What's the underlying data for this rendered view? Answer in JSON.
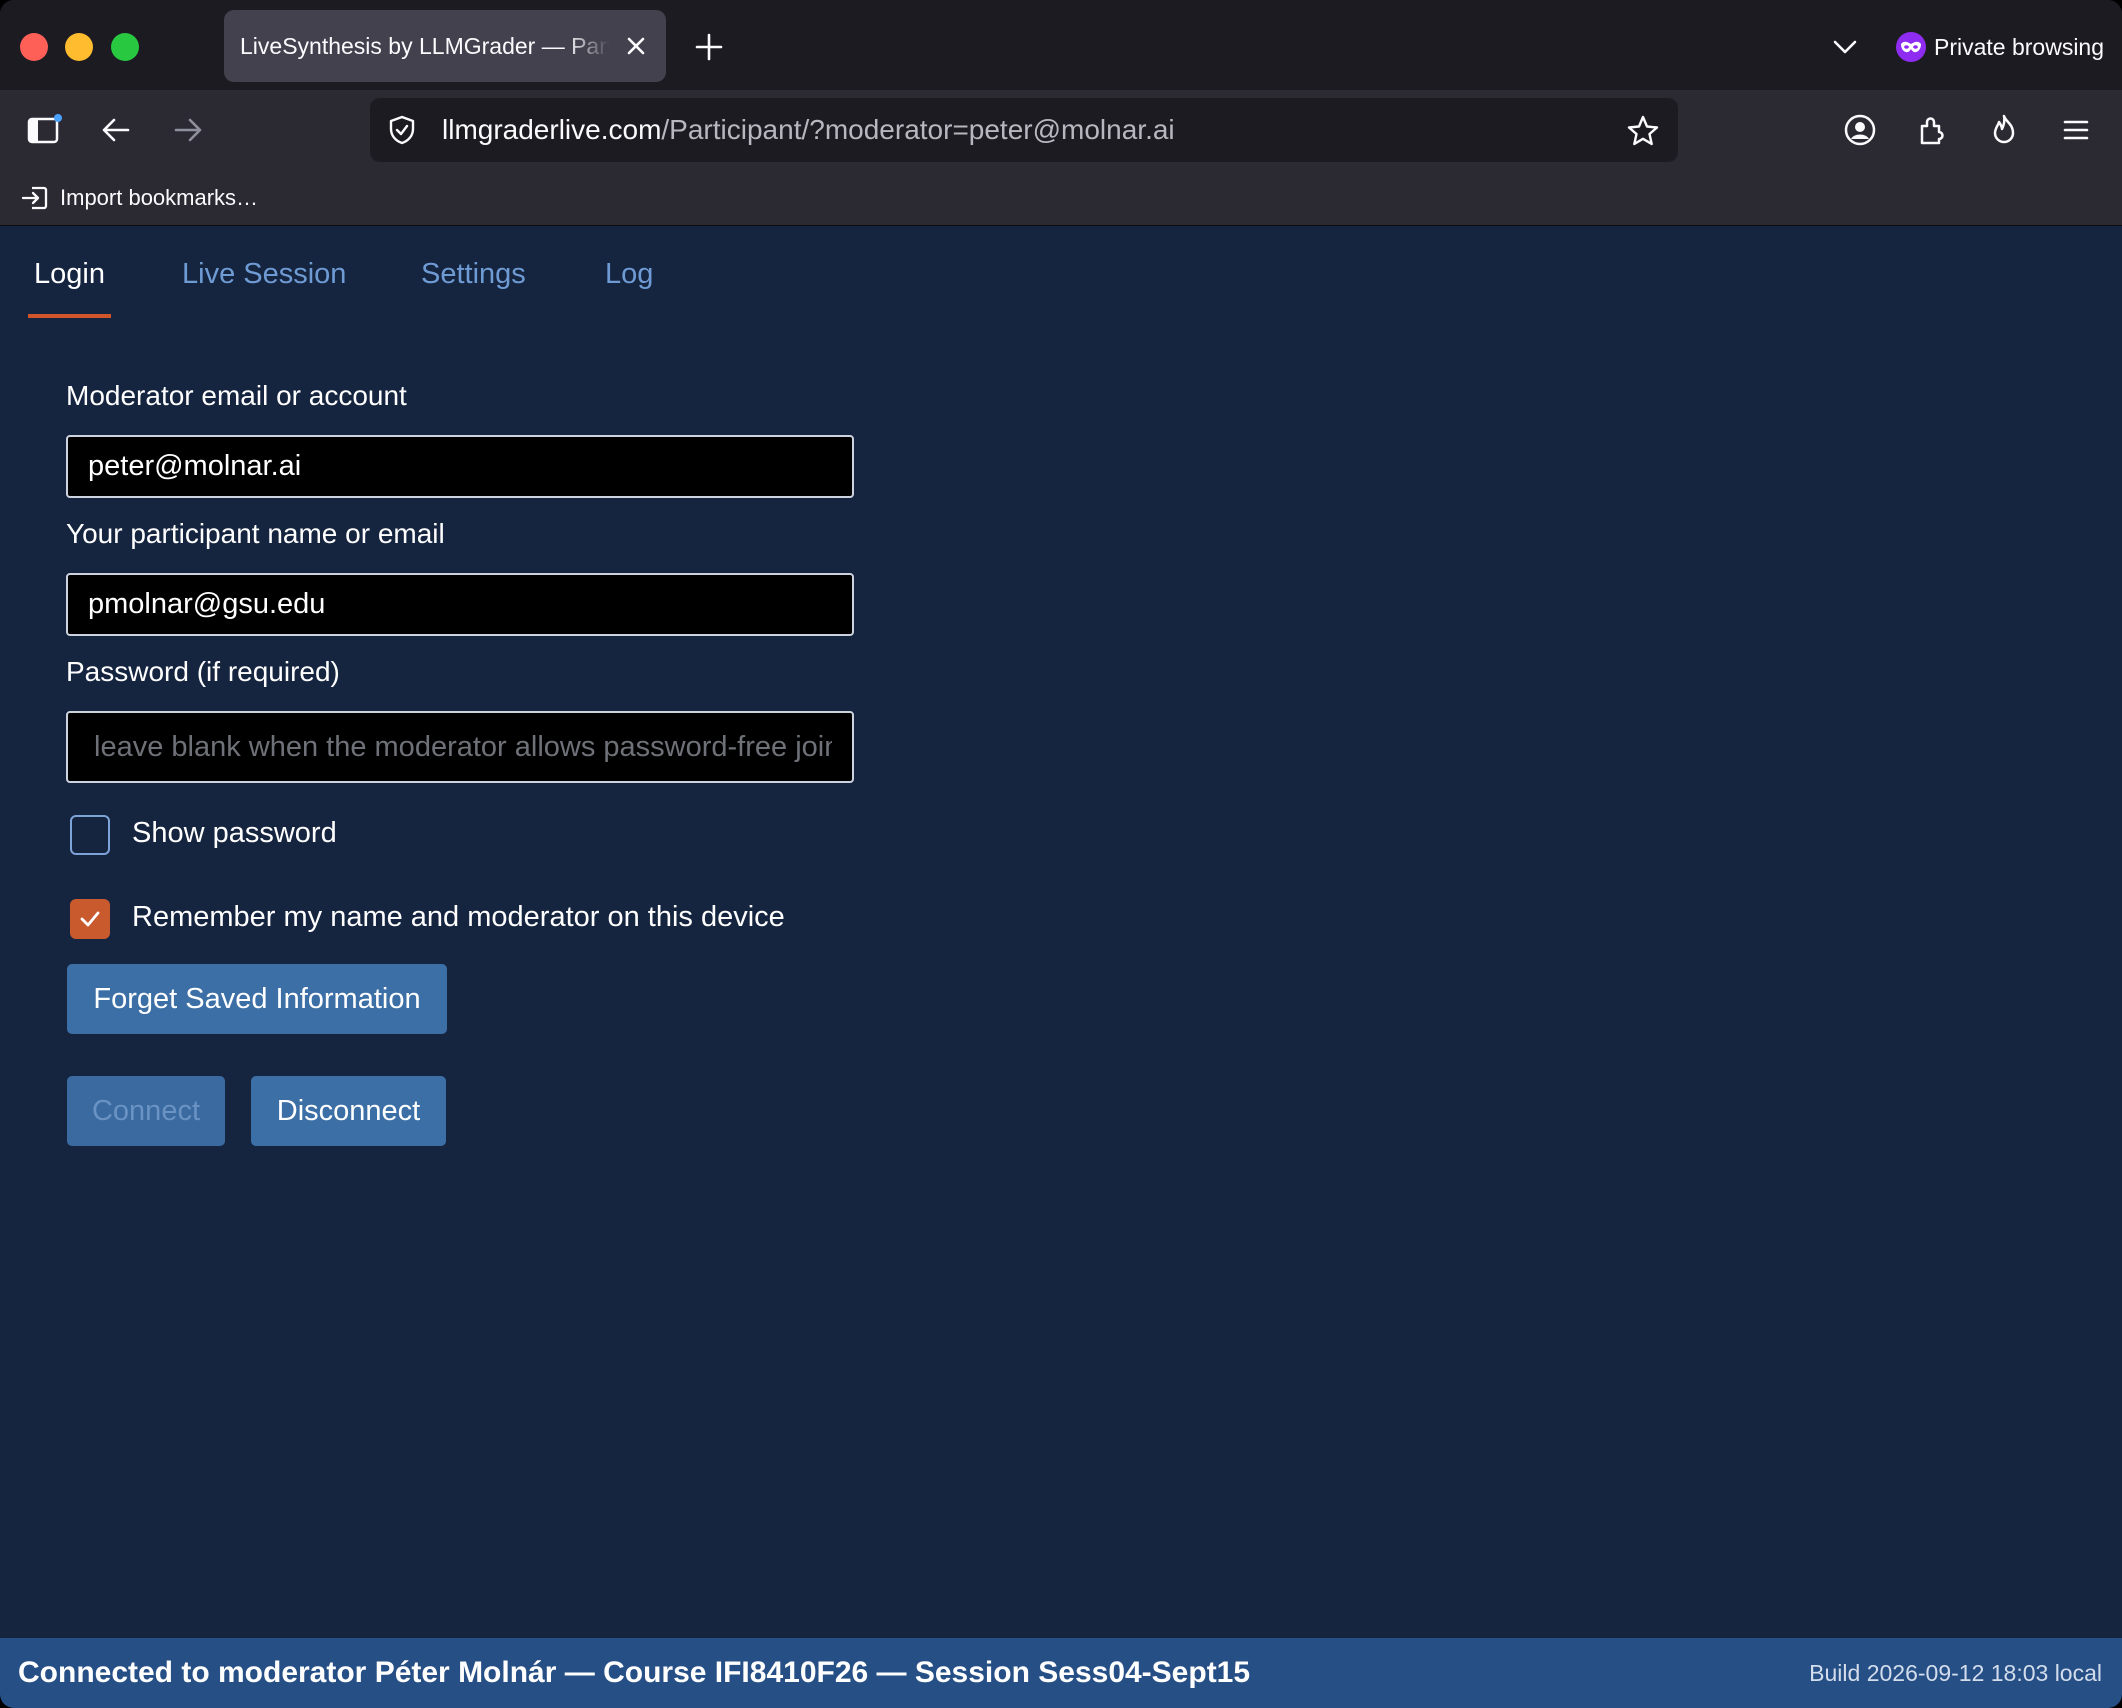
{
  "browser": {
    "tab_title": "LiveSynthesis by LLMGrader — Participant",
    "private_label": "Private browsing",
    "url_domain": "llmgraderlive.com",
    "url_path": "/Participant/?moderator=peter@molnar.ai",
    "bookmarks_import": "Import bookmarks…"
  },
  "tabs": [
    {
      "label": "Login",
      "active": true
    },
    {
      "label": "Live Session",
      "active": false
    },
    {
      "label": "Settings",
      "active": false
    },
    {
      "label": "Log",
      "active": false
    }
  ],
  "form": {
    "moderator_label": "Moderator email or account",
    "moderator_value": "peter@molnar.ai",
    "participant_label": "Your participant name or email",
    "participant_value": "pmolnar@gsu.edu",
    "password_label": "Password (if required)",
    "password_value": "",
    "password_placeholder": "leave blank when the moderator allows password-free join",
    "show_password_label": "Show password",
    "show_password_checked": false,
    "remember_label": "Remember my name and moderator on this device",
    "remember_checked": true,
    "forget_button": "Forget Saved Information",
    "connect_button": "Connect",
    "connect_disabled": true,
    "disconnect_button": "Disconnect"
  },
  "status": {
    "message": "Connected to moderator Péter Molnár — Course IFI8410F26 — Session Sess04-Sept15",
    "build": "Build 2026-09-12 18:03 local"
  },
  "colors": {
    "page_bg": "#15243f",
    "accent": "#d0552b",
    "button": "#3c6fa6",
    "status_bar": "#264f86"
  },
  "icons": [
    "close-icon",
    "plus-icon",
    "chevron-down-icon",
    "private-mask-icon",
    "sidebar-icon",
    "back-arrow-icon",
    "forward-arrow-icon",
    "shield-icon",
    "star-icon",
    "account-icon",
    "extensions-icon",
    "firefox-view-icon",
    "menu-icon",
    "import-icon",
    "checkmark-icon"
  ]
}
